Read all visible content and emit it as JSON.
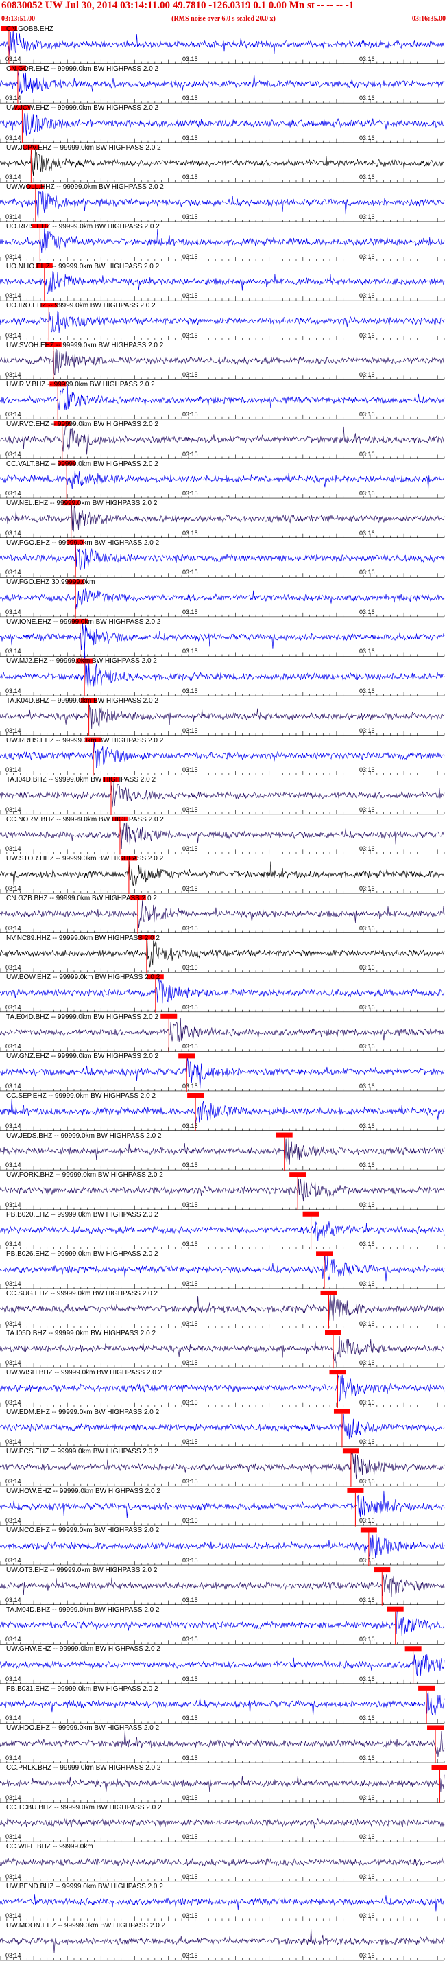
{
  "header": {
    "title": "60830052 UW Jul 30, 2014 03:14:11.00   49.7810 -126.0319  0.1 0.00 Mn st -- -- --  -1",
    "subtitle": "(RMS noise over 6.0 s scaled 20.0 x)",
    "start_time": "03:13:51.00",
    "end_time": "03:16:35.00"
  },
  "colors": {
    "trace_blue": "#0000ee",
    "trace_navy": "#2a1466",
    "trace_black": "#000000",
    "pick": "#ff0000",
    "text": "#000000",
    "header_red": "#e00000"
  },
  "chart_data": {
    "type": "seismogram",
    "time_ticks": [
      "03:14",
      "03:15",
      "03:16"
    ],
    "stations": [
      {
        "label": "CN.GOBB.EHZ",
        "color": "blue",
        "pick": 0.02
      },
      {
        "label": "CN.GOR.EHZ -- 99999.0km BW HIGHPASS  2.0  2",
        "color": "blue",
        "pick": 0.04
      },
      {
        "label": "UW.JCW.EHZ -- 99999.0km BW HIGHPASS  2.0  2",
        "color": "blue",
        "pick": 0.05
      },
      {
        "label": "UW.JCPV.EHZ -- 99999.0km BW HIGHPASS  2.0  2",
        "color": "black",
        "pick": 0.07
      },
      {
        "label": "UW.WOLL.HHZ -- 99999.0km BW HIGHPASS  2.0  2",
        "color": "blue",
        "pick": 0.08
      },
      {
        "label": "UO.RRIS.EHZ -- 99999.0km BW HIGHPASS  2.0  2",
        "color": "blue",
        "pick": 0.09
      },
      {
        "label": "UO.NLIO.EHZ -- 99999.0km BW HIGHPASS  2.0  2",
        "color": "blue",
        "pick": 0.1
      },
      {
        "label": "UO.IRO.EHZ -- 99999.0km BW HIGHPASS  2.0  2",
        "color": "blue",
        "pick": 0.11
      },
      {
        "label": "UW.SVOH.EHZ -- 99999.0km BW HIGHPASS  2.0  2",
        "color": "navy",
        "pick": 0.12
      },
      {
        "label": "UW.RIV.BHZ -- 99999.0km BW HIGHPASS  2.0  2",
        "color": "blue",
        "pick": 0.13
      },
      {
        "label": "UW.RVC.EHZ -- 99999.0km BW HIGHPASS  2.0  2",
        "color": "navy",
        "pick": 0.14
      },
      {
        "label": "CC.VALT.BHZ -- 99999.0km BW HIGHPASS  2.0  2",
        "color": "blue",
        "pick": 0.15
      },
      {
        "label": "UW.NEL.EHZ -- 99999.0km BW HIGHPASS  2.0  2",
        "color": "navy",
        "pick": 0.16
      },
      {
        "label": "UW.PGO.EHZ -- 99999.0km BW HIGHPASS  2.0  2",
        "color": "blue",
        "pick": 0.17
      },
      {
        "label": "UW.FGO.EHZ 30.99999.0km",
        "color": "blue",
        "pick": 0.17
      },
      {
        "label": "UW.IONE.EHZ -- 99999.0km BW HIGHPASS  2.0  2",
        "color": "blue",
        "pick": 0.18
      },
      {
        "label": "UW.MJ2.EHZ -- 99999.0km BW HIGHPASS  2.0  2",
        "color": "blue",
        "pick": 0.19
      },
      {
        "label": "TA.K04D.BHZ -- 99999.0km BW HIGHPASS  2.0  2",
        "color": "navy",
        "pick": 0.2
      },
      {
        "label": "UW.RRHS.EHZ -- 99999.0km BW HIGHPASS  2.0  2",
        "color": "blue",
        "pick": 0.21
      },
      {
        "label": "TA.I04D.BHZ -- 99999.0km BW HIGHPASS  2.0  2",
        "color": "navy",
        "pick": 0.25
      },
      {
        "label": "CC.NORM.BHZ -- 99999.0km BW HIGHPASS  2.0  2",
        "color": "navy",
        "pick": 0.27
      },
      {
        "label": "UW.STOR.HHZ -- 99999.0km BW HIGHPASS  2.0  2",
        "color": "black",
        "pick": 0.29
      },
      {
        "label": "CN.GZB.BHZ -- 99999.0km BW HIGHPASS  2.0  2",
        "color": "navy",
        "pick": 0.31
      },
      {
        "label": "NV.NC89.HHZ -- 99999.0km BW HIGHPASS  2.0  2",
        "color": "black",
        "pick": 0.33
      },
      {
        "label": "UW.BOW.EHZ -- 99999.0km BW HIGHPASS  2.0  2",
        "color": "blue",
        "pick": 0.35
      },
      {
        "label": "TA.E04D.BHZ -- 99999.0km BW HIGHPASS  2.0  2",
        "color": "navy",
        "pick": 0.38
      },
      {
        "label": "UW.GNZ.EHZ -- 99999.0km BW HIGHPASS  2.0  2",
        "color": "blue",
        "pick": 0.42
      },
      {
        "label": "CC.SEP.EHZ -- 99999.0km BW HIGHPASS  2.0  2",
        "color": "blue",
        "pick": 0.44
      },
      {
        "label": "UW.JEDS.BHZ -- 99999.0km BW HIGHPASS  2.0  2",
        "color": "navy",
        "pick": 0.64
      },
      {
        "label": "UW.FORK.BHZ -- 99999.0km BW HIGHPASS  2.0  2",
        "color": "navy",
        "pick": 0.67
      },
      {
        "label": "PB.B020.EHZ -- 99999.0km BW HIGHPASS  2.0  2",
        "color": "blue",
        "pick": 0.7
      },
      {
        "label": "PB.B026.EHZ -- 99999.0km BW HIGHPASS  2.0  2",
        "color": "blue",
        "pick": 0.73
      },
      {
        "label": "CC.SUG.EHZ -- 99999.0km BW HIGHPASS  2.0  2",
        "color": "navy",
        "pick": 0.74
      },
      {
        "label": "TA.I05D.BHZ -- 99999.0km BW HIGHPASS  2.0  2",
        "color": "navy",
        "pick": 0.75
      },
      {
        "label": "UW.WISH.BHZ -- 99999.0km BW HIGHPASS  2.0  2",
        "color": "blue",
        "pick": 0.76
      },
      {
        "label": "UW.EDM.EHZ -- 99999.0km BW HIGHPASS  2.0  2",
        "color": "blue",
        "pick": 0.77
      },
      {
        "label": "UW.PCS.EHZ -- 99999.0km BW HIGHPASS  2.0  2",
        "color": "navy",
        "pick": 0.79
      },
      {
        "label": "UW.HOW.EHZ -- 99999.0km BW HIGHPASS  2.0  2",
        "color": "blue",
        "pick": 0.8
      },
      {
        "label": "UW.NCO.EHZ -- 99999.0km BW HIGHPASS  2.0  2",
        "color": "blue",
        "pick": 0.83
      },
      {
        "label": "UW.OT3.EHZ -- 99999.0km BW HIGHPASS  2.0  2",
        "color": "navy",
        "pick": 0.86
      },
      {
        "label": "TA.M04D.BHZ -- 99999.0km BW HIGHPASS  2.0  2",
        "color": "blue",
        "pick": 0.89
      },
      {
        "label": "UW.GHW.EHZ -- 99999.0km BW HIGHPASS  2.0  2",
        "color": "blue",
        "pick": 0.93
      },
      {
        "label": "PB.B031.EHZ -- 99999.0km BW HIGHPASS  2.0  2",
        "color": "blue",
        "pick": 0.96
      },
      {
        "label": "UW.HDO.EHZ -- 99999.0km BW HIGHPASS  2.0  2",
        "color": "navy",
        "pick": 0.98
      },
      {
        "label": "CC.PRLK.BHZ -- 99999.0km BW HIGHPASS  2.0  2",
        "color": "navy",
        "pick": 0.99
      },
      {
        "label": "CC.TCBU.BHZ -- 99999.0km BW HIGHPASS  2.0  2",
        "color": "navy",
        "pick": null
      },
      {
        "label": "CC.WIFE.BHZ -- 99999.0km",
        "color": "navy",
        "pick": null
      },
      {
        "label": "UW.BEND.BHZ -- 99999.0km BW HIGHPASS  2.0  2",
        "color": "blue",
        "pick": null
      },
      {
        "label": "UW.MOON.EHZ -- 99999.0km BW HIGHPASS  2.0  2",
        "color": "navy",
        "pick": null
      }
    ]
  }
}
